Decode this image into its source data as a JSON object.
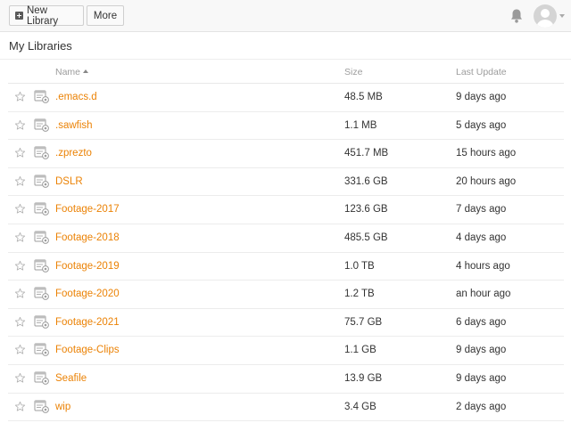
{
  "toolbar": {
    "new_library_label": "New Library",
    "more_label": "More"
  },
  "header_icons": {
    "notifications": "bell-icon",
    "account": "avatar-icon"
  },
  "page_title": "My Libraries",
  "columns": {
    "name": "Name",
    "size": "Size",
    "last_update": "Last Update",
    "sort": "name-ascending"
  },
  "colors": {
    "link": "#eb8205",
    "header_text": "#9c9c9c"
  },
  "libraries": [
    {
      "name": ".emacs.d",
      "size": "48.5 MB",
      "updated": "9 days ago"
    },
    {
      "name": ".sawfish",
      "size": "1.1 MB",
      "updated": "5 days ago"
    },
    {
      "name": ".zprezto",
      "size": "451.7 MB",
      "updated": "15 hours ago"
    },
    {
      "name": "DSLR",
      "size": "331.6 GB",
      "updated": "20 hours ago"
    },
    {
      "name": "Footage-2017",
      "size": "123.6 GB",
      "updated": "7 days ago"
    },
    {
      "name": "Footage-2018",
      "size": "485.5 GB",
      "updated": "4 days ago"
    },
    {
      "name": "Footage-2019",
      "size": "1.0 TB",
      "updated": "4 hours ago"
    },
    {
      "name": "Footage-2020",
      "size": "1.2 TB",
      "updated": "an hour ago"
    },
    {
      "name": "Footage-2021",
      "size": "75.7 GB",
      "updated": "6 days ago"
    },
    {
      "name": "Footage-Clips",
      "size": "1.1 GB",
      "updated": "9 days ago"
    },
    {
      "name": "Seafile",
      "size": "13.9 GB",
      "updated": "9 days ago"
    },
    {
      "name": "wip",
      "size": "3.4 GB",
      "updated": "2 days ago"
    }
  ]
}
